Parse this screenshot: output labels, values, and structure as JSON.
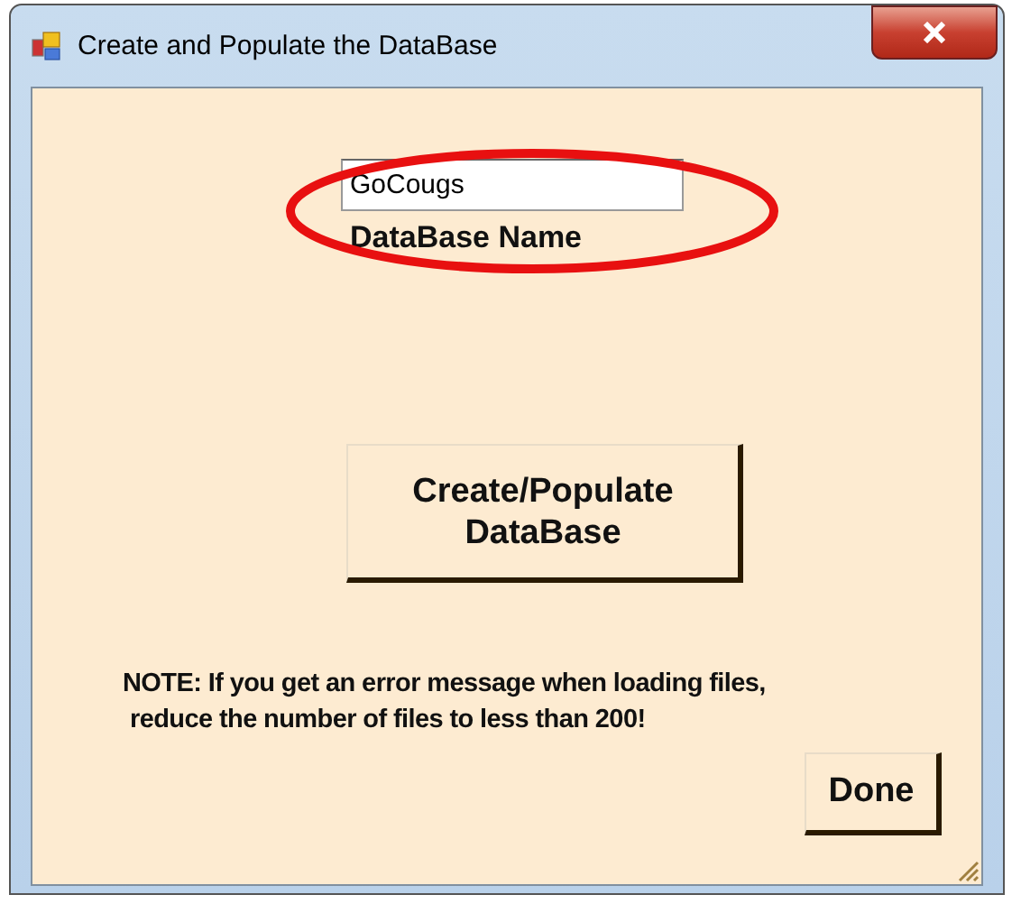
{
  "window": {
    "title": "Create and Populate the DataBase"
  },
  "name_field": {
    "value": "GoCougs",
    "label": "DataBase Name"
  },
  "create_button": {
    "lines": [
      "Create/Populate",
      "DataBase"
    ]
  },
  "note": {
    "lines": [
      "NOTE:  If you get an error message when loading files,",
      "reduce the number of files to less than 200!"
    ]
  },
  "done_button": {
    "label": "Done"
  }
}
